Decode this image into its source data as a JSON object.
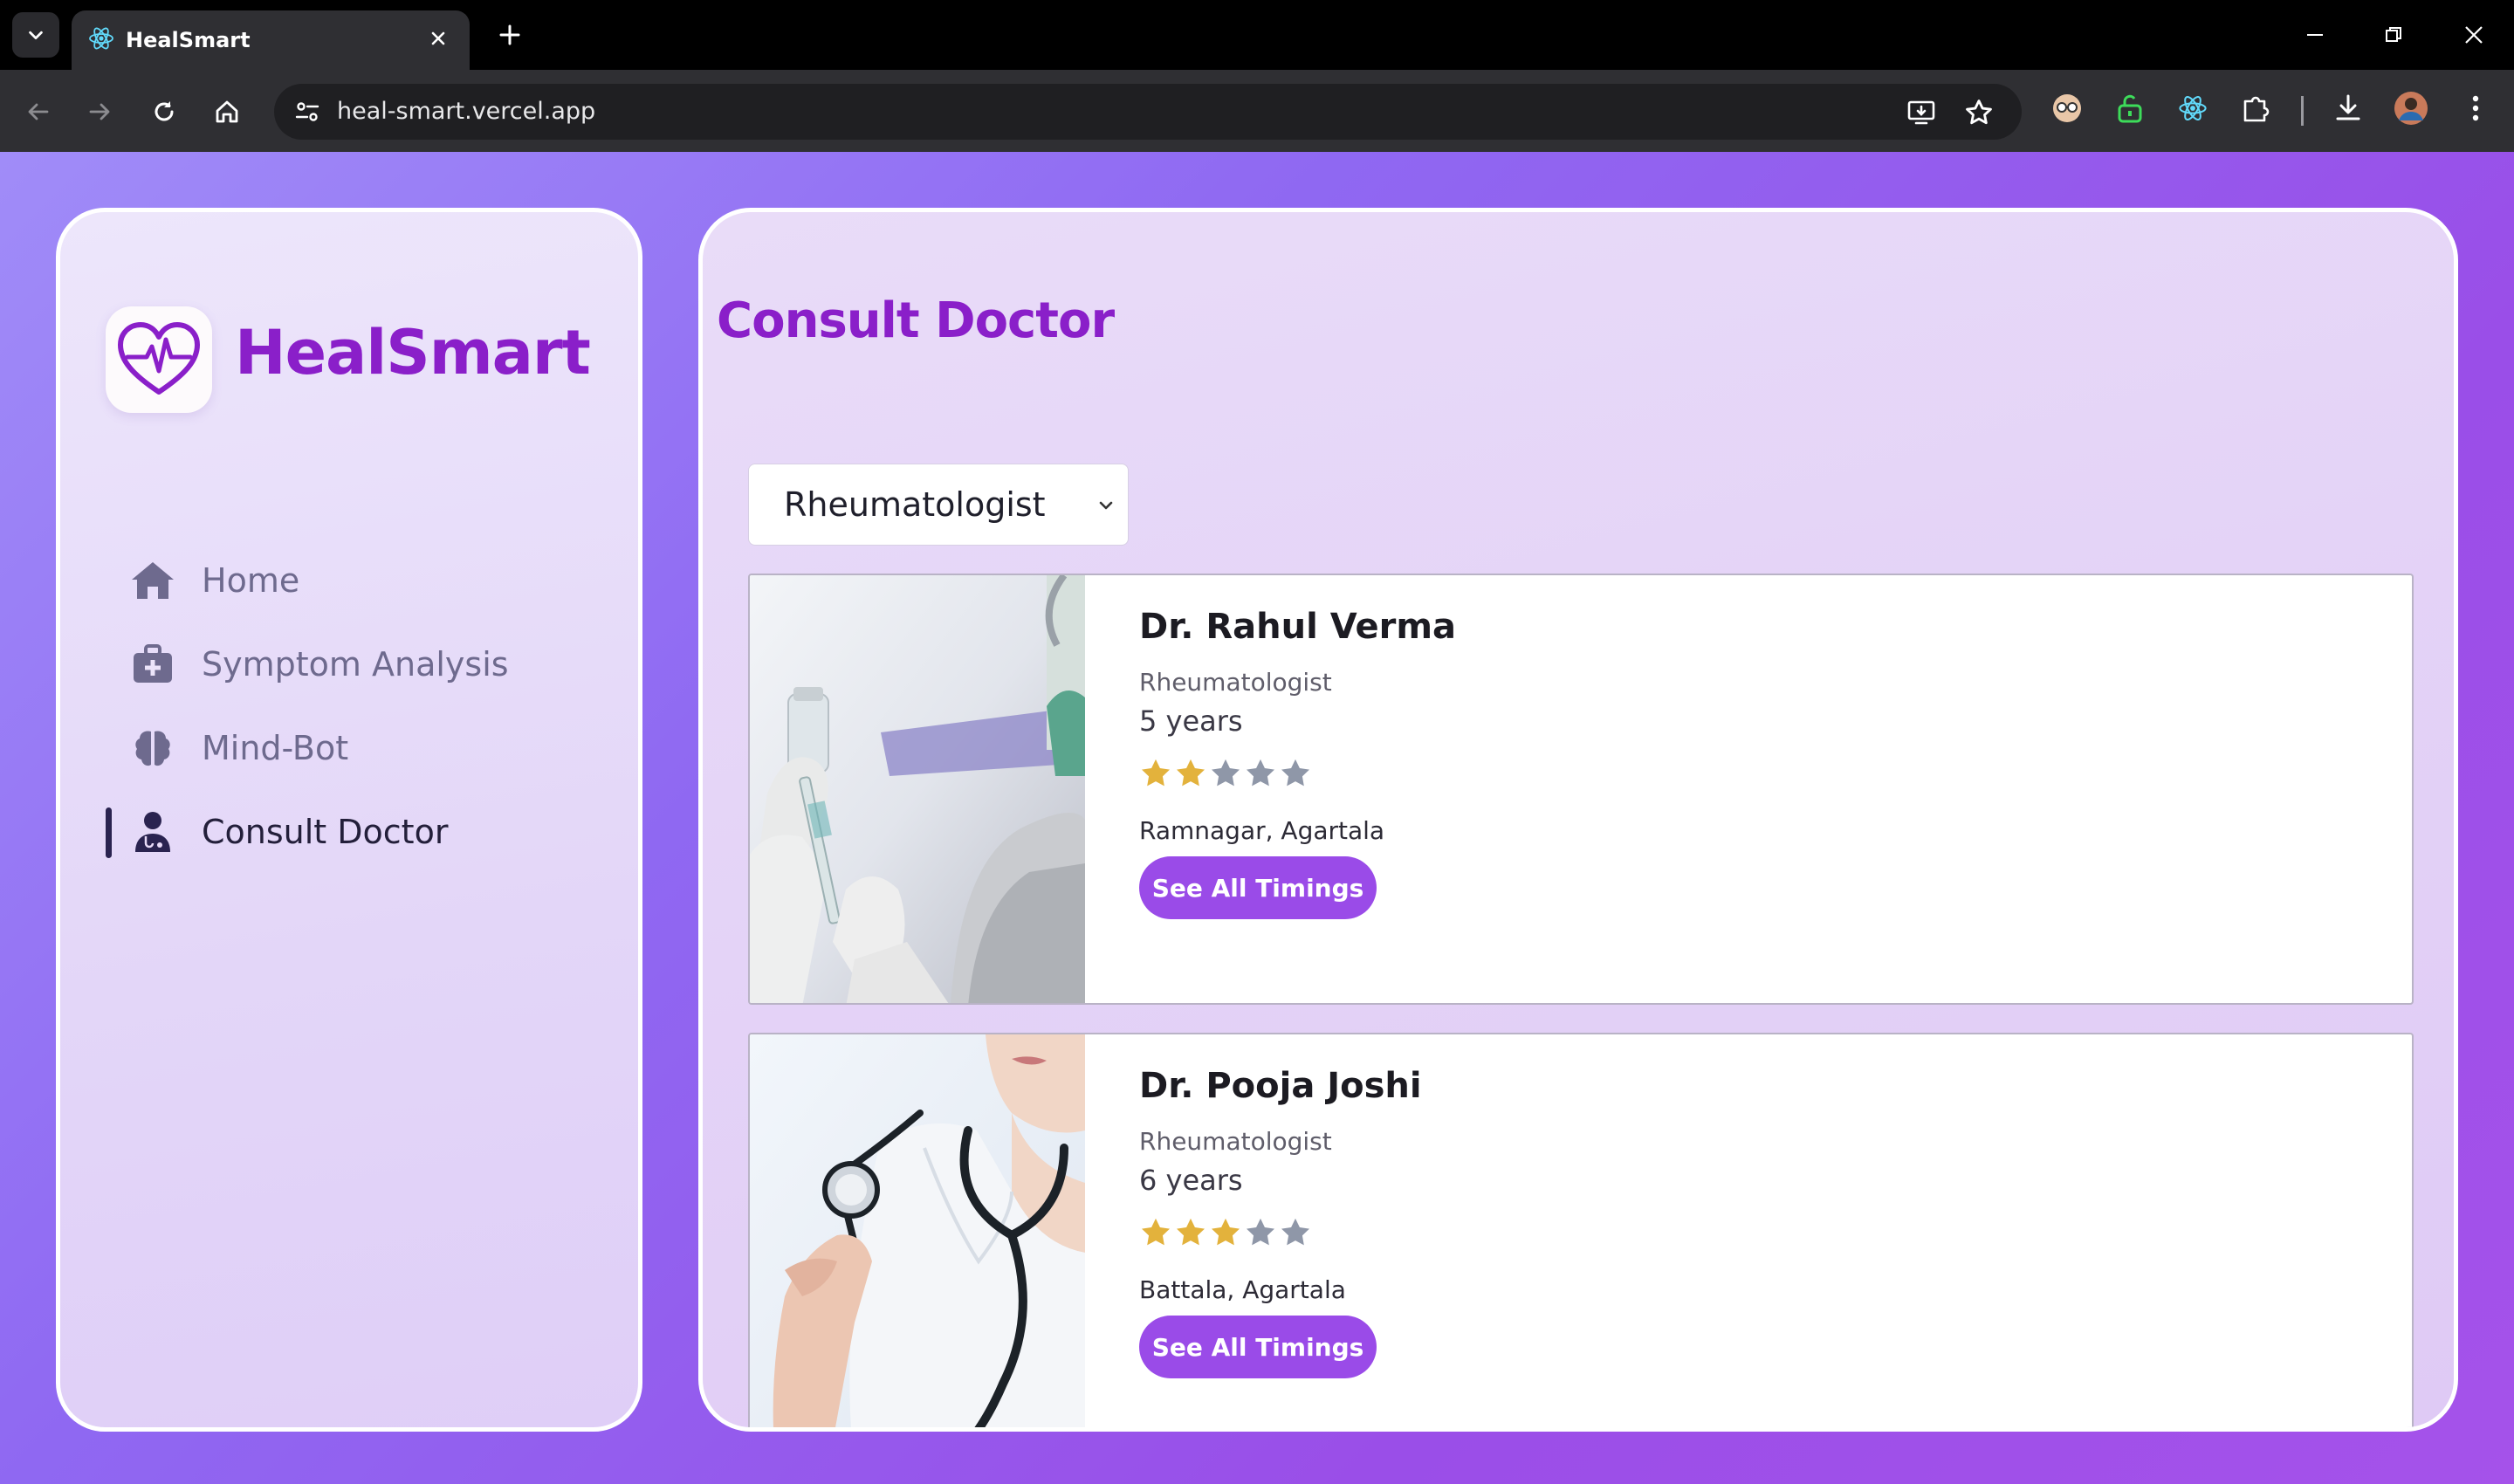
{
  "browser": {
    "tab_title": "HealSmart",
    "url": "heal-smart.vercel.app"
  },
  "app": {
    "brand": "HealSmart",
    "page_title": "Consult Doctor",
    "accent_color": "#8a1fc9",
    "button_color": "#9a4be8",
    "star_filled_color": "#e3b23c",
    "star_empty_color": "#8f97a8"
  },
  "sidebar": {
    "items": [
      {
        "label": "Home",
        "icon": "home-icon",
        "active": false
      },
      {
        "label": "Symptom Analysis",
        "icon": "medical-kit-icon",
        "active": false
      },
      {
        "label": "Mind-Bot",
        "icon": "brain-icon",
        "active": false
      },
      {
        "label": "Consult Doctor",
        "icon": "doctor-icon",
        "active": true
      }
    ]
  },
  "filter": {
    "selected": "Rheumatologist"
  },
  "doctors": [
    {
      "name": "Dr. Rahul Verma",
      "specialty": "Rheumatologist",
      "experience": "5 years",
      "rating": 2,
      "rating_max": 5,
      "location": "Ramnagar, Agartala",
      "button_label": "See All Timings",
      "photo": "syringe-vial-photo"
    },
    {
      "name": "Dr. Pooja Joshi",
      "specialty": "Rheumatologist",
      "experience": "6 years",
      "rating": 3,
      "rating_max": 5,
      "location": "Battala, Agartala",
      "button_label": "See All Timings",
      "photo": "doctor-stethoscope-photo"
    }
  ]
}
